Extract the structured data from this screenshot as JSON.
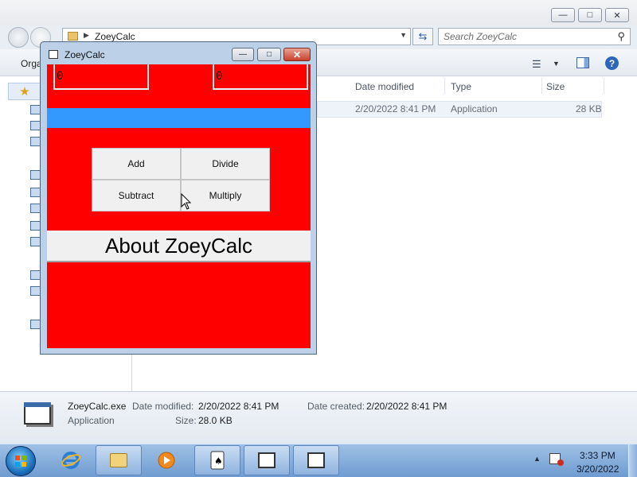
{
  "explorer": {
    "breadcrumb": "ZoeyCalc",
    "search_placeholder": "Search ZoeyCalc",
    "organize_label": "Orga",
    "columns": {
      "date_modified": "Date modified",
      "type": "Type",
      "size": "Size"
    },
    "file": {
      "date_modified": "2/20/2022 8:41 PM",
      "type": "Application",
      "size": "28 KB"
    },
    "details": {
      "name": "ZoeyCalc.exe",
      "type": "Application",
      "date_modified_label": "Date modified:",
      "date_modified": "2/20/2022 8:41 PM",
      "date_created_label": "Date created:",
      "date_created": "2/20/2022 8:41 PM",
      "size_label": "Size:",
      "size": "28.0 KB"
    }
  },
  "calc": {
    "title": "ZoeyCalc",
    "input_a": "0",
    "input_b": "0",
    "buttons": {
      "add": "Add",
      "divide": "Divide",
      "subtract": "Subtract",
      "multiply": "Multiply"
    },
    "about_label": "About ZoeyCalc",
    "background_color": "#ff0000",
    "band_color": "#3399ff"
  },
  "taskbar": {
    "time": "3:33 PM",
    "date": "3/20/2022"
  },
  "icons": [
    "back-icon",
    "forward-icon",
    "refresh-icon",
    "search-icon",
    "help-icon",
    "star-icon",
    "start-icon",
    "ie-icon",
    "folder-icon",
    "media-player-icon",
    "solitaire-icon",
    "window-icon",
    "flag-icon",
    "cursor-icon"
  ]
}
